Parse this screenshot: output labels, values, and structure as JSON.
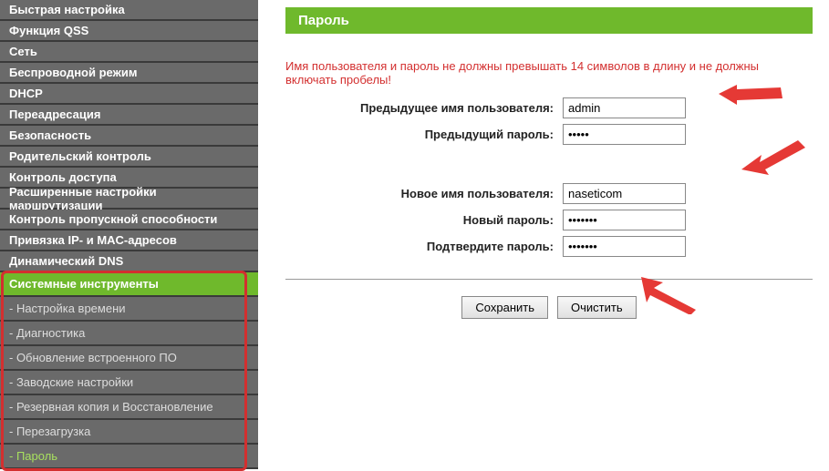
{
  "nav": {
    "items": [
      "Быстрая настройка",
      "Функция QSS",
      "Сеть",
      "Беспроводной режим",
      "DHCP",
      "Переадресация",
      "Безопасность",
      "Родительский контроль",
      "Контроль доступа",
      "Расширенные настройки маршрутизации",
      "Контроль пропускной способности",
      "Привязка IP- и MAC-адресов",
      "Динамический DNS",
      "Системные инструменты"
    ],
    "subs": [
      "- Настройка времени",
      "- Диагностика",
      "- Обновление встроенного ПО",
      "- Заводские настройки",
      "- Резервная копия и Восстановление",
      "- Перезагрузка",
      "- Пароль"
    ]
  },
  "page": {
    "title": "Пароль",
    "warning": "Имя пользователя и пароль не должны превышать 14 символов в длину и не должны включать пробелы!"
  },
  "form": {
    "prev_user_label": "Предыдущее имя пользователя:",
    "prev_user_value": "admin",
    "prev_pass_label": "Предыдущий пароль:",
    "prev_pass_value": "•••••",
    "new_user_label": "Новое имя пользователя:",
    "new_user_value": "naseticom",
    "new_pass_label": "Новый пароль:",
    "new_pass_value": "•••••••",
    "confirm_pass_label": "Подтвердите пароль:",
    "confirm_pass_value": "•••••••"
  },
  "buttons": {
    "save": "Сохранить",
    "clear": "Очистить"
  }
}
